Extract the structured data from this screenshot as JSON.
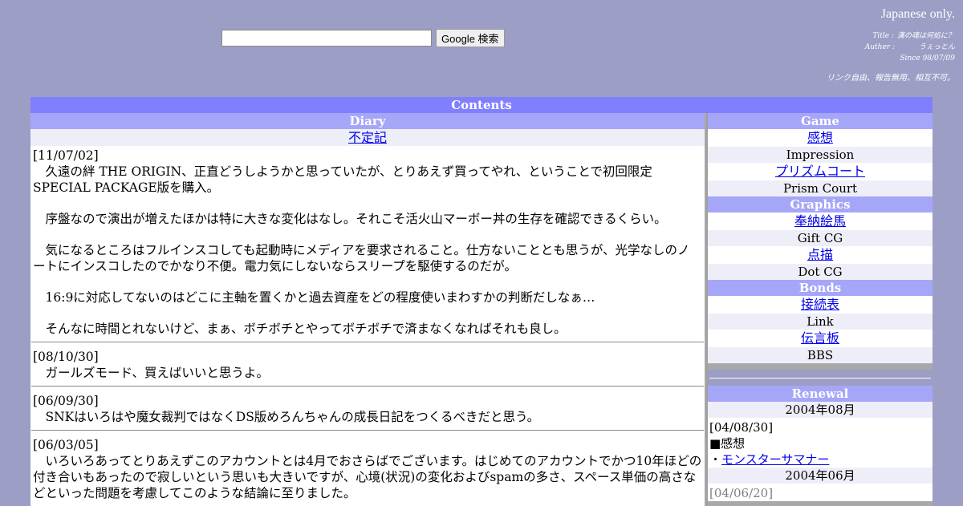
{
  "search": {
    "placeholder": "",
    "value": "",
    "button_label": "Google 検索"
  },
  "header": {
    "japanese_only": "Japanese only.",
    "title_label": "Title :",
    "title_value": "漢の魂は何処に？",
    "author_label": "Auther :",
    "author_value": "うぇっとん",
    "since": "Since 98/07/09",
    "link_policy": "リンク自由、報告無用、相互不可。"
  },
  "contents_title": "Contents",
  "diary": {
    "heading": "Diary",
    "link_label": "不定記",
    "entries": [
      {
        "date": "[11/07/02]",
        "paragraphs": [
          "久遠の絆 THE ORIGIN、正直どうしようかと思っていたが、とりあえず買ってやれ、ということで初回限定SPECIAL PACKAGE版を購入。",
          "序盤なので演出が増えたほかは特に大きな変化はなし。それこそ活火山マーボー丼の生存を確認できるくらい。",
          "気になるところはフルインスコしても起動時にメディアを要求されること。仕方ないこととも思うが、光学なしのノートにインスコしたのでかなり不便。電力気にしないならスリープを駆使するのだが。",
          "16:9に対応してないのはどこに主軸を置くかと過去資産をどの程度使いまわすかの判断だしなぁ…",
          "そんなに時間とれないけど、まぁ、ボチボチとやってボチボチで済まなくなればそれも良し。"
        ]
      },
      {
        "date": "[08/10/30]",
        "paragraphs": [
          "ガールズモード、買えばいいと思うよ。"
        ]
      },
      {
        "date": "[06/09/30]",
        "paragraphs": [
          "SNKはいろはや魔女裁判ではなくDS版めろんちゃんの成長日記をつくるべきだと思う。"
        ]
      },
      {
        "date": "[06/03/05]",
        "paragraphs": [
          "いろいろあってとりあえずこのアカウントとは4月でおさらばでございます。はじめてのアカウントでかつ10年ほどの付き合いもあったので寂しいという思いも大きいですが、心境(状況)の変化およびspamの多さ、スペース単価の高さなどといった問題を考慮してこのような結論に至りました。"
        ]
      }
    ]
  },
  "sidebar": {
    "game": {
      "heading": "Game",
      "items": [
        {
          "link": "感想",
          "sub": "Impression"
        },
        {
          "link": "プリズムコート",
          "sub": "Prism Court"
        }
      ]
    },
    "graphics": {
      "heading": "Graphics",
      "items": [
        {
          "link": "奉納絵馬",
          "sub": "Gift CG"
        },
        {
          "link": "点描",
          "sub": "Dot CG"
        }
      ]
    },
    "bonds": {
      "heading": "Bonds",
      "items": [
        {
          "link": "接続表",
          "sub": "Link"
        },
        {
          "link": "伝言板",
          "sub": "BBS"
        }
      ]
    },
    "renewal": {
      "heading": "Renewal",
      "months": [
        {
          "month": "2004年08月",
          "date": "[04/08/30]",
          "category": "■感想",
          "bullet": "・",
          "item": "モンスターサマナー"
        },
        {
          "month": "2004年06月",
          "date": "[04/06/20]"
        }
      ]
    }
  }
}
